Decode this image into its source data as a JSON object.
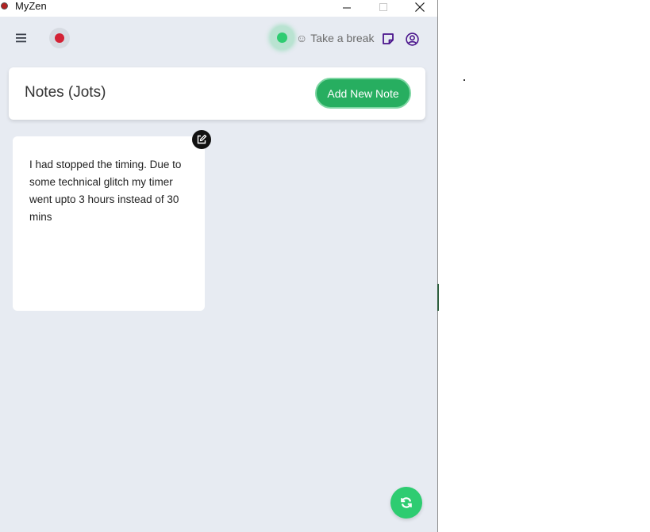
{
  "window": {
    "title": "MyZen"
  },
  "toolbar": {
    "menu_icon": "hamburger-menu-icon",
    "record_icon": "record-dot-icon",
    "status_color": "#2ecc71",
    "break_icon": "☺",
    "break_label": "Take a break",
    "notes_icon": "sticky-note-icon",
    "user_icon": "user-circle-icon"
  },
  "header": {
    "title": "Notes (Jots)",
    "add_button_label": "Add New Note"
  },
  "notes": [
    {
      "text": "I had stopped the timing. Due to some technical glitch my timer went upto 3 hours instead of 30 mins"
    }
  ],
  "colors": {
    "accent": "#27ae60",
    "record": "#d32235",
    "icon_purple": "#4a148c",
    "background": "#e7ebf2"
  }
}
